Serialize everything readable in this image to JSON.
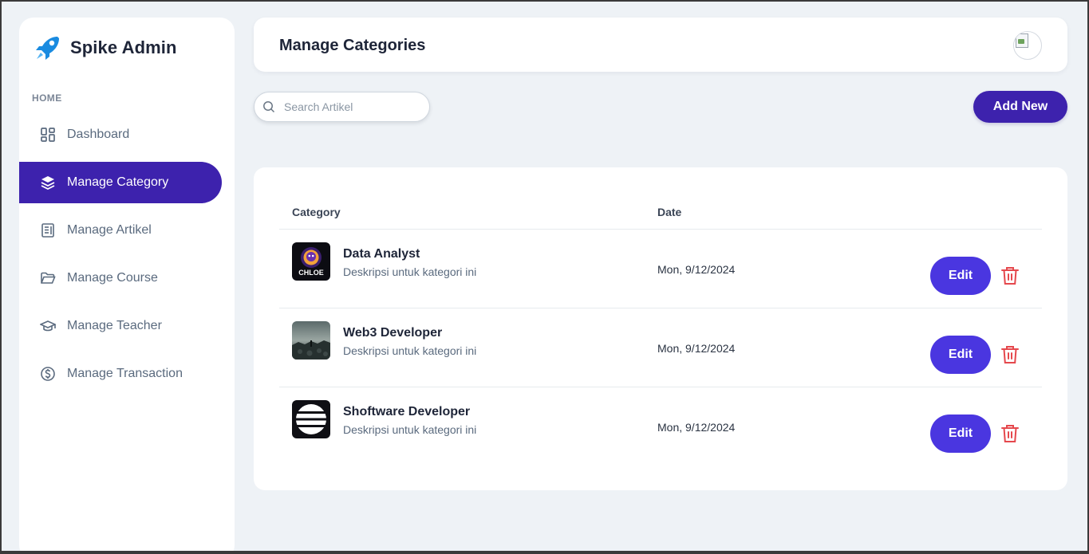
{
  "brand": {
    "name": "Spike Admin",
    "icon": "rocket-icon",
    "color": "#1a8be0"
  },
  "sidebar": {
    "heading": "HOME",
    "items": [
      {
        "label": "Dashboard",
        "icon": "dashboard-icon",
        "active": false
      },
      {
        "label": "Manage Category",
        "icon": "layers-icon",
        "active": true
      },
      {
        "label": "Manage Artikel",
        "icon": "article-icon",
        "active": false
      },
      {
        "label": "Manage Course",
        "icon": "folder-icon",
        "active": false
      },
      {
        "label": "Manage Teacher",
        "icon": "graduation-cap-icon",
        "active": false
      },
      {
        "label": "Manage Transaction",
        "icon": "dollar-circle-icon",
        "active": false
      }
    ]
  },
  "header": {
    "title": "Manage Categories",
    "avatar": "avatar-broken-image"
  },
  "toolbar": {
    "search_placeholder": "Search Artikel",
    "search_value": "",
    "add_label": "Add New"
  },
  "table": {
    "columns": [
      "Category",
      "Date"
    ],
    "rows": [
      {
        "name": "Data Analyst",
        "description": "Deskripsi untuk kategori ini",
        "date": "Mon, 9/12/2024",
        "thumb": "chloe-logo",
        "thumb_text": "CHLOE",
        "edit_label": "Edit"
      },
      {
        "name": "Web3 Developer",
        "description": "Deskripsi untuk kategori ini",
        "date": "Mon, 9/12/2024",
        "thumb": "dark-landscape-image",
        "edit_label": "Edit"
      },
      {
        "name": "Shoftware Developer",
        "description": "Deskripsi untuk kategori ini",
        "date": "Mon, 9/12/2024",
        "thumb": "striped-circle-logo",
        "edit_label": "Edit"
      }
    ]
  },
  "colors": {
    "primary": "#3d22ad",
    "edit": "#4a36e0",
    "delete": "#e5484d",
    "background": "#eef2f6"
  }
}
